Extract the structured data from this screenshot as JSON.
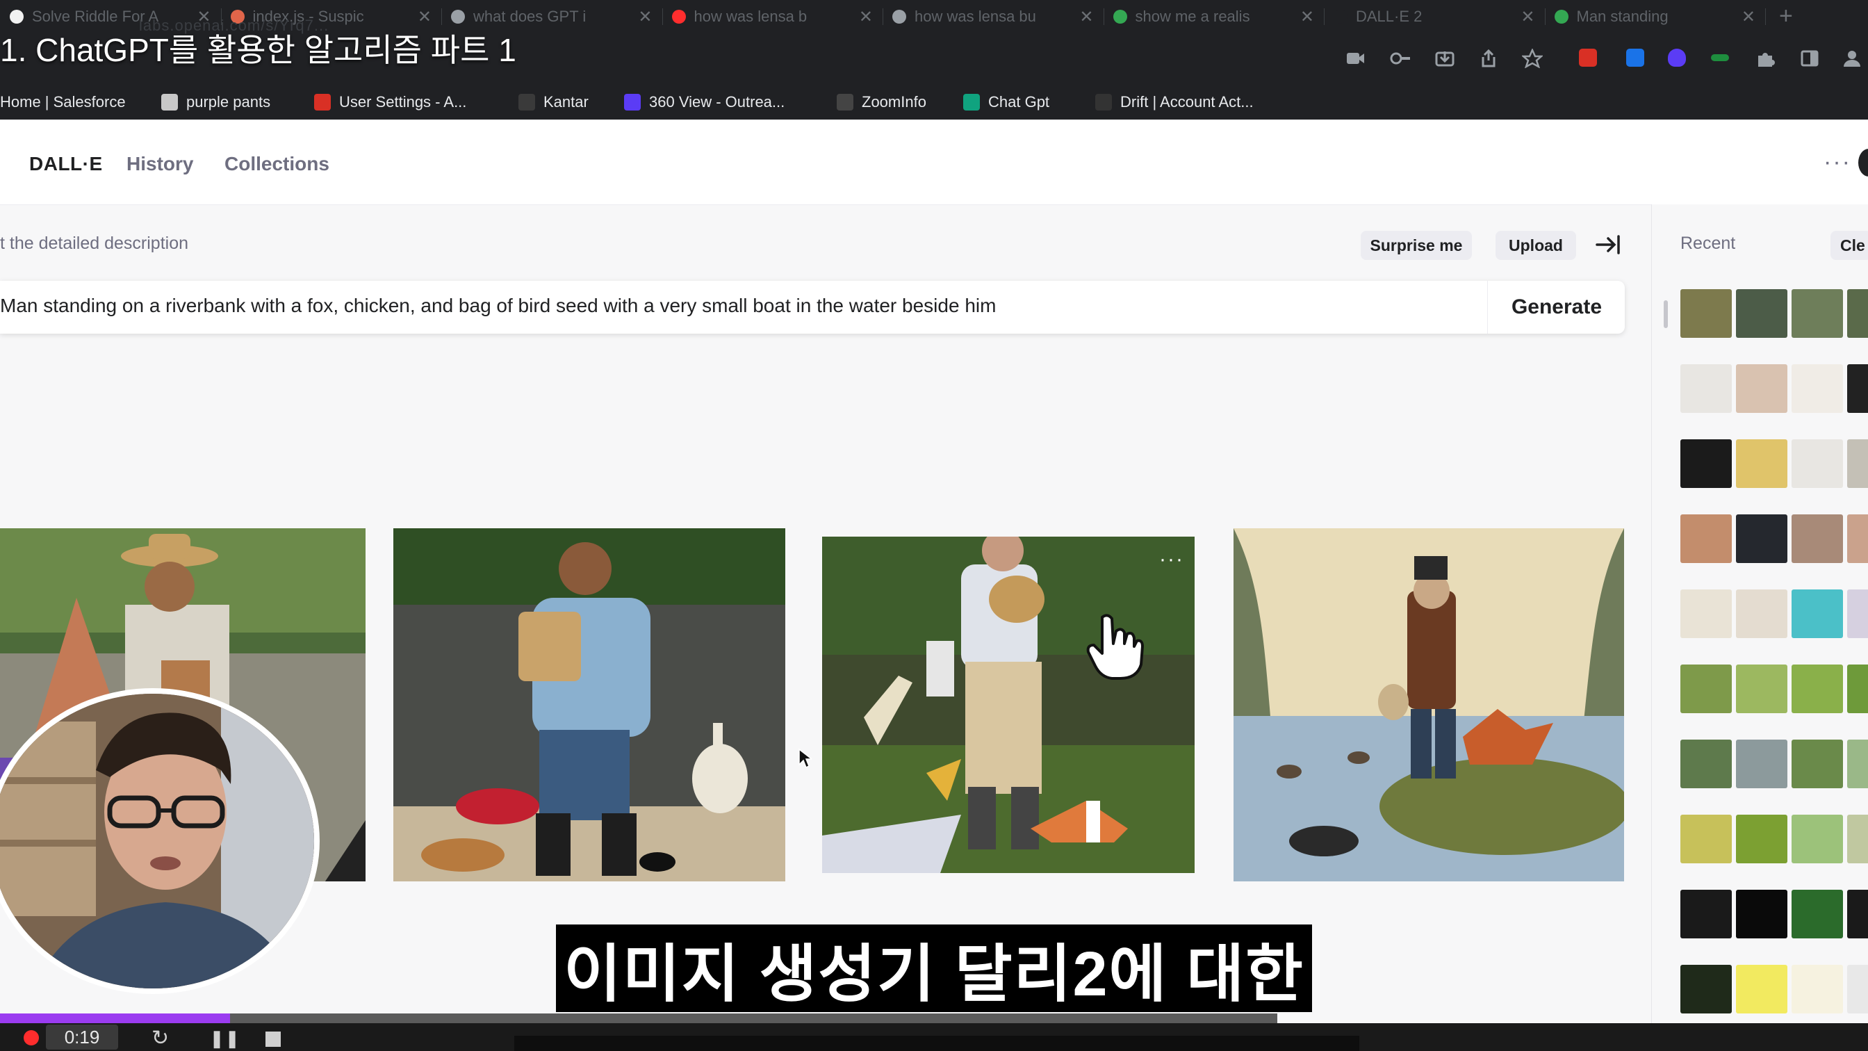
{
  "video_title": "1. ChatGPT를 활용한 알고리즘 파트 1",
  "browser": {
    "tabs": [
      {
        "title": "Solve Riddle For A",
        "fav": "#f1f1f1"
      },
      {
        "title": "index.js - Suspic",
        "fav": "#e0654a"
      },
      {
        "title": "what does GPT i",
        "fav": "#9aa0a6"
      },
      {
        "title": "how was lensa b",
        "fav": "#ff2e2e"
      },
      {
        "title": "how was lensa bu",
        "fav": "#9aa0a6"
      },
      {
        "title": "show me a realis",
        "fav": "#34a853"
      },
      {
        "title": "DALL·E 2",
        "fav": "#202124"
      },
      {
        "title": "Man standing",
        "fav": "#34a853"
      }
    ],
    "url_partial": "labs.openai.com/s/Yrq7...",
    "bookmarks": [
      {
        "label": "Home | Salesforce",
        "color": "#00a1e0"
      },
      {
        "label": "purple pants",
        "color": "#c8c8c8"
      },
      {
        "label": "User Settings - A...",
        "color": "#d93025"
      },
      {
        "label": "Kantar",
        "color": "#3a3a3a"
      },
      {
        "label": "360 View - Outrea...",
        "color": "#5b3cf5"
      },
      {
        "label": "ZoomInfo",
        "color": "#444444"
      },
      {
        "label": "Chat Gpt",
        "color": "#10a37f"
      },
      {
        "label": "Drift | Account Act...",
        "color": "#333333"
      }
    ]
  },
  "dalle": {
    "brand": "DALL·E",
    "nav": [
      "History",
      "Collections"
    ],
    "prompt_label": "Start with the detailed description",
    "prompt_label_visible": "t the detailed description",
    "surprise_label": "Surprise me",
    "upload_label": "Upload",
    "prompt_text": "Man standing on a riverbank with a fox, chicken, and bag of bird seed with a very small boat in the water beside him",
    "prompt_text_visible": "Man standing on a riverbank with a fox, chicken, and bag of bird seed with a very small boat in the water beside him",
    "generate_label": "Generate",
    "recent_label": "Recent",
    "clear_label": "Clear",
    "clear_label_visible": "Cle"
  },
  "subtitle": "이미지 생성기 달리2에 대한",
  "player": {
    "time": "0:19",
    "progress": 0.18
  }
}
